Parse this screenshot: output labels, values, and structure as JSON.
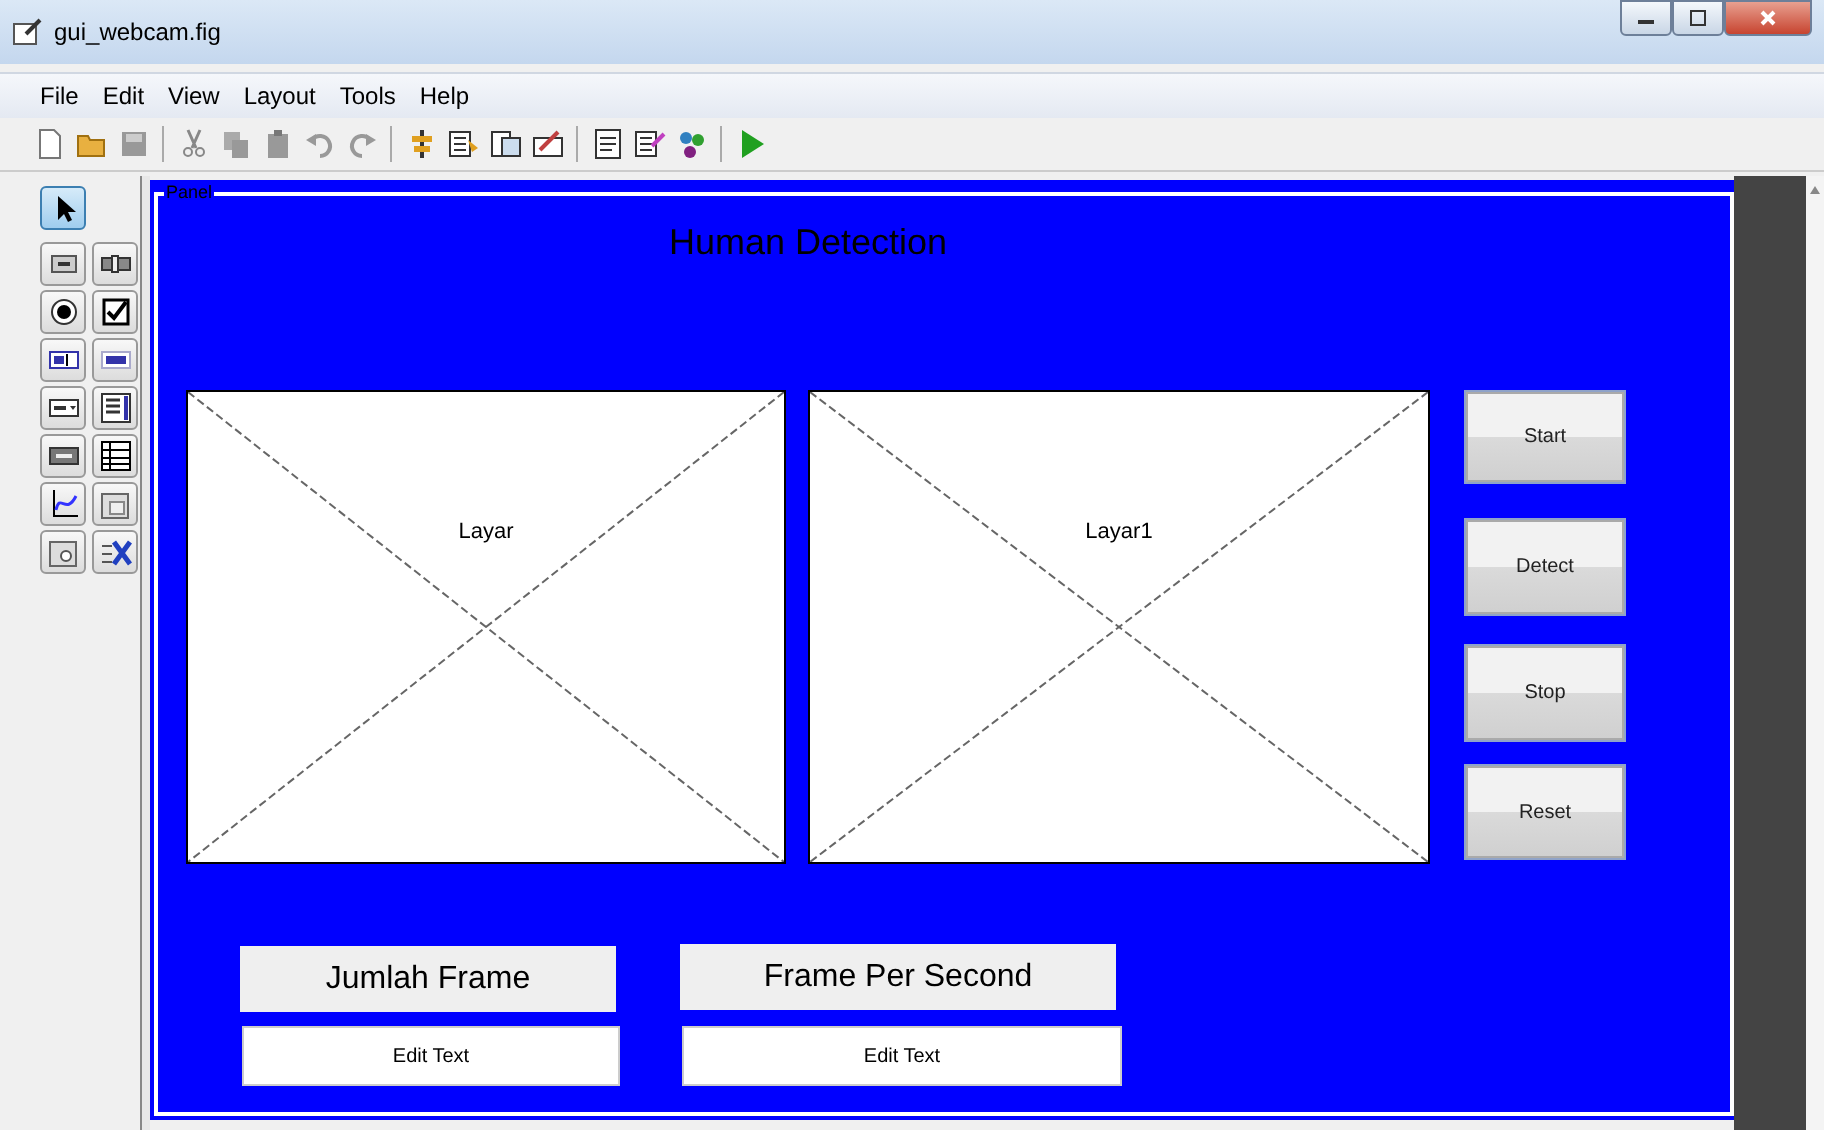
{
  "window": {
    "title": "gui_webcam.fig"
  },
  "menu": [
    {
      "label": "File"
    },
    {
      "label": "Edit"
    },
    {
      "label": "View"
    },
    {
      "label": "Layout"
    },
    {
      "label": "Tools"
    },
    {
      "label": "Help"
    }
  ],
  "palette": [
    {
      "kind": "pointer",
      "selected": true
    },
    {
      "kind": "pushbutton",
      "selected": false
    },
    {
      "kind": "slider",
      "selected": false
    },
    {
      "kind": "radio",
      "selected": false
    },
    {
      "kind": "checkbox",
      "selected": false
    },
    {
      "kind": "edit",
      "selected": false
    },
    {
      "kind": "static",
      "selected": false
    },
    {
      "kind": "popup",
      "selected": false
    },
    {
      "kind": "listbox",
      "selected": false
    },
    {
      "kind": "toggle",
      "selected": false
    },
    {
      "kind": "table",
      "selected": false
    },
    {
      "kind": "axes",
      "selected": false
    },
    {
      "kind": "panel",
      "selected": false
    },
    {
      "kind": "buttongroup",
      "selected": false
    },
    {
      "kind": "activex",
      "selected": false
    }
  ],
  "panel": {
    "title": "Panel",
    "heading": "Human Detection",
    "axes": [
      {
        "label": "Layar"
      },
      {
        "label": "Layar1"
      }
    ],
    "buttons": [
      {
        "label": "Start"
      },
      {
        "label": "Detect"
      },
      {
        "label": "Stop"
      },
      {
        "label": "Reset"
      }
    ],
    "static_texts": [
      {
        "text": "Jumlah Frame"
      },
      {
        "text": "Frame Per Second"
      }
    ],
    "edit_texts": [
      {
        "text": "Edit Text"
      },
      {
        "text": "Edit Text"
      }
    ]
  }
}
